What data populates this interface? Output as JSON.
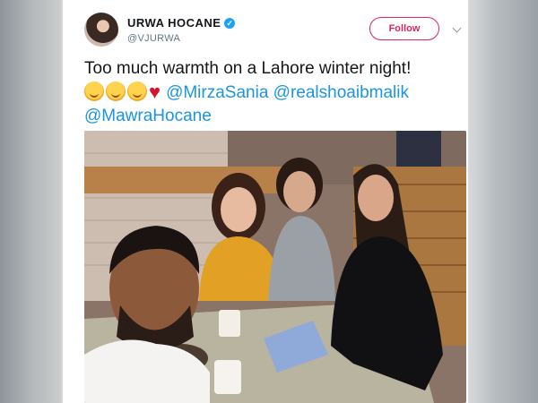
{
  "tweet": {
    "display_name": "URWA HOCANE",
    "handle": "@VJURWA",
    "follow_label": "Follow",
    "text_main": "Too much warmth on a Lahore winter night!",
    "mentions": [
      "@MirzaSania",
      "@realshoaibmalik",
      "@MawraHocane"
    ],
    "emojis": [
      "hugging-face-emoji",
      "hugging-face-emoji",
      "hugging-face-emoji",
      "red-heart-emoji"
    ]
  },
  "colors": {
    "follow": "#e0245e",
    "verified": "#1da1f2",
    "mention": "#1b95e0",
    "heart": "#d4152f"
  }
}
